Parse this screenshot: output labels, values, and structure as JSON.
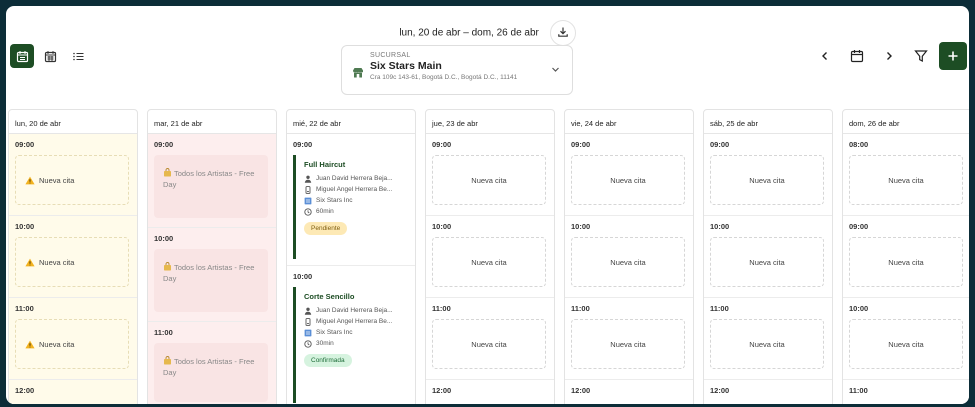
{
  "header": {
    "date_range": "lun, 20 de abr – dom, 26 de abr"
  },
  "branch": {
    "label": "SUCURSAL",
    "name": "Six Stars Main",
    "address": "Cra 109c 143-61, Bogotá D.C., Bogotá D.C., 11141"
  },
  "colors": {
    "accent": "#1d4d24",
    "pending": "#fde9b5",
    "confirmed": "#d6f3df",
    "free_day": "#fdeeee",
    "warning_day": "#fffbea"
  },
  "days": [
    {
      "label": "lun, 20 de abr",
      "slots": [
        {
          "time": "09:00",
          "action": "Nueva cita"
        },
        {
          "time": "10:00",
          "action": "Nueva cita"
        },
        {
          "time": "11:00",
          "action": "Nueva cita"
        },
        {
          "time": "12:00"
        }
      ]
    },
    {
      "label": "mar, 21 de abr",
      "slots": [
        {
          "time": "09:00",
          "free_line1": "Todos los Artistas - Free",
          "free_line2": "Day"
        },
        {
          "time": "10:00",
          "free_line1": "Todos los Artistas - Free",
          "free_line2": "Day"
        },
        {
          "time": "11:00",
          "free_line1": "Todos los Artistas - Free",
          "free_line2": "Day"
        }
      ]
    },
    {
      "label": "mié, 22 de abr",
      "slots": [
        {
          "time": "09:00",
          "service": "Full Haircut",
          "artist": "Juan David Herrera Beja...",
          "client": "Miguel Angel Herrera Be...",
          "company": "Six Stars Inc",
          "duration": "60min",
          "status": "Pendiente"
        },
        {
          "time": "10:00",
          "service": "Corte Sencillo",
          "artist": "Juan David Herrera Beja...",
          "client": "Miguel Angel Herrera Be...",
          "company": "Six Stars Inc",
          "duration": "30min",
          "status": "Confirmada"
        }
      ]
    },
    {
      "label": "jue, 23 de abr",
      "slots": [
        {
          "time": "09:00",
          "action": "Nueva cita"
        },
        {
          "time": "10:00",
          "action": "Nueva cita"
        },
        {
          "time": "11:00",
          "action": "Nueva cita"
        },
        {
          "time": "12:00"
        }
      ]
    },
    {
      "label": "vie, 24 de abr",
      "slots": [
        {
          "time": "09:00",
          "action": "Nueva cita"
        },
        {
          "time": "10:00",
          "action": "Nueva cita"
        },
        {
          "time": "11:00",
          "action": "Nueva cita"
        },
        {
          "time": "12:00"
        }
      ]
    },
    {
      "label": "sáb, 25 de abr",
      "slots": [
        {
          "time": "09:00",
          "action": "Nueva cita"
        },
        {
          "time": "10:00",
          "action": "Nueva cita"
        },
        {
          "time": "11:00",
          "action": "Nueva cita"
        },
        {
          "time": "12:00"
        }
      ]
    },
    {
      "label": "dom, 26 de abr",
      "slots": [
        {
          "time": "08:00",
          "action": "Nueva cita"
        },
        {
          "time": "09:00",
          "action": "Nueva cita"
        },
        {
          "time": "10:00",
          "action": "Nueva cita"
        },
        {
          "time": "11:00"
        }
      ]
    }
  ]
}
